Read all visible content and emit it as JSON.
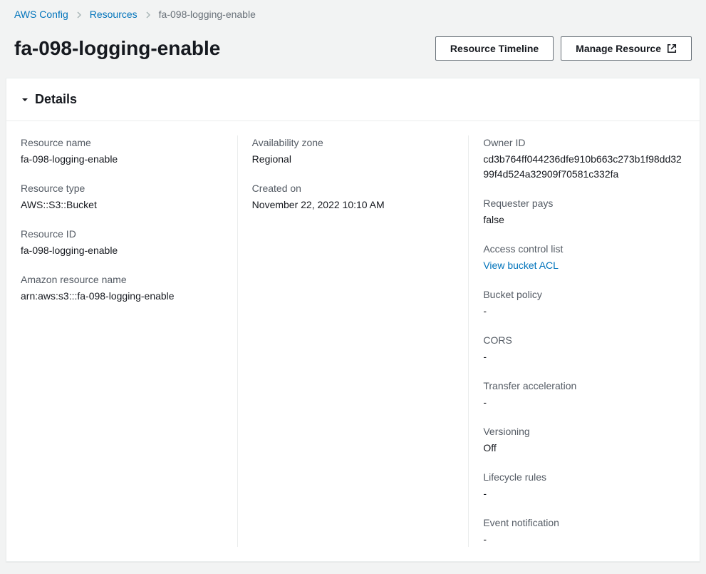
{
  "breadcrumb": {
    "root": "AWS Config",
    "level1": "Resources",
    "current": "fa-098-logging-enable"
  },
  "header": {
    "title": "fa-098-logging-enable",
    "resource_timeline_label": "Resource Timeline",
    "manage_resource_label": "Manage Resource"
  },
  "panel": {
    "title": "Details"
  },
  "details": {
    "col1": {
      "resource_name": {
        "label": "Resource name",
        "value": "fa-098-logging-enable"
      },
      "resource_type": {
        "label": "Resource type",
        "value": "AWS::S3::Bucket"
      },
      "resource_id": {
        "label": "Resource ID",
        "value": "fa-098-logging-enable"
      },
      "arn": {
        "label": "Amazon resource name",
        "value": "arn:aws:s3:::fa-098-logging-enable"
      }
    },
    "col2": {
      "availability_zone": {
        "label": "Availability zone",
        "value": "Regional"
      },
      "created_on": {
        "label": "Created on",
        "value": "November 22, 2022 10:10 AM"
      }
    },
    "col3": {
      "owner_id": {
        "label": "Owner ID",
        "value": "cd3b764ff044236dfe910b663c273b1f98dd3299f4d524a32909f70581c332fa"
      },
      "requester_pays": {
        "label": "Requester pays",
        "value": "false"
      },
      "acl": {
        "label": "Access control list",
        "link_label": "View bucket ACL"
      },
      "bucket_policy": {
        "label": "Bucket policy",
        "value": "-"
      },
      "cors": {
        "label": "CORS",
        "value": "-"
      },
      "transfer_acceleration": {
        "label": "Transfer acceleration",
        "value": "-"
      },
      "versioning": {
        "label": "Versioning",
        "value": "Off"
      },
      "lifecycle_rules": {
        "label": "Lifecycle rules",
        "value": "-"
      },
      "event_notification": {
        "label": "Event notification",
        "value": "-"
      }
    }
  }
}
